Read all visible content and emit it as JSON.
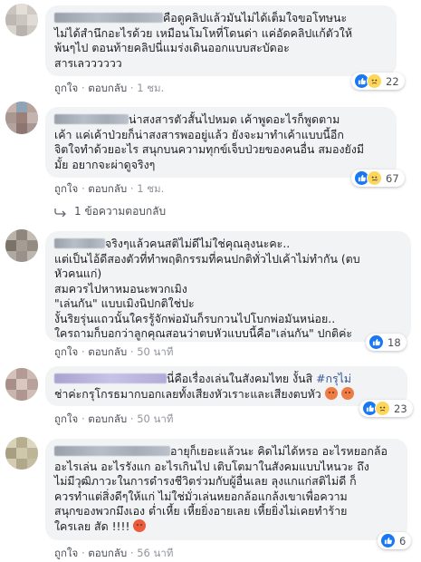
{
  "labels": {
    "like": "ถูกใจ",
    "reply": "ตอบกลับ",
    "dot": "·"
  },
  "colors": {
    "like_blue": "#1877f2",
    "bubble_bg": "#f2f3f5",
    "meta_gray": "#90949c",
    "link_blue": "#385898"
  },
  "comments": [
    {
      "lines": [
        "คือดูคลิปแล้วมันไม่ได้เต็มใจขอโทษนะ",
        "ไม่ได้สำนึกอะไรด้วย เหมือนโมโหที่โดนด่า แค่อัดคลิปแก้ตัวให้",
        "พ้นๆไป ตอนท้ายคลิปนี่แมร่งเดินออกแบบสะบัดอะ",
        "สารเลวววววว"
      ],
      "time": "1 ชม.",
      "reaction_count": "22",
      "reaction_icons": [
        "like-icon",
        "sad-face-icon"
      ]
    },
    {
      "lines": [
        "น่าสงสารตัวสั้นไปหมด เค้าพูดอะไรก็พูดตาม",
        "เค้า แค่เค้าป่วยก็น่าสงสารพออยู่แล้ว ยังจะมาทำเค้าแบบนี้อีก",
        "จิตใจทำด้วยอะไร สนุกบนความทุกข์เจ็บป่วยของคนอื่น สมองยังมี",
        "มั้ย อยากจะผ่าดูจริงๆ"
      ],
      "time": "1 ชม.",
      "reaction_count": "67",
      "reaction_icons": [
        "like-icon",
        "sad-face-icon"
      ],
      "reply_link": "1 ข้อความตอบกลับ"
    },
    {
      "lines": [
        "จริงๆแล้วคนสติไม่ดีไม่ใช่คุณลุงนะคะ..",
        "แต่เป็นไอ้ดีสองตัวที่ทำพฤติกรรมที่คนปกติทั่วไปเค้าไม่ทำกัน (ตบ",
        "หัวคนแก่)",
        "สมควรไปหาหมอนะพวกเมิง",
        "\"เล่นกัน\" แบบเมิงนิปกติใช่ปะ",
        "งั้นริยรุ่นแถวนั้นใครรู้จักพ่อมันก็รบกวนไปโบกพ่อมันหน่อย..",
        "ใครถามก็บอกว่าลูกคุณสอนว่าตบหัวแบบนี้คือ\"เล่นกัน\" ปกติค่ะ"
      ],
      "name_partial": "ผัง",
      "time": "50 นาที",
      "reaction_count": "18",
      "reaction_icons": [
        "like-icon"
      ]
    },
    {
      "lines": [
        "นี่คือเรื่องเล่นในสังคมไทย งั้นสิ",
        "ช่าค่ะกรุโกรธมากบอกเลยทั้งเสียงหัวเราะและเสียงตบหัว"
      ],
      "hashtag": "#กรุไม่",
      "time": "50 นาที",
      "reaction_count": "23",
      "reaction_icons": [
        "like-icon",
        "sad-face-icon"
      ]
    },
    {
      "lines": [
        "อายุก็เยอะแล้วนะ คิดไม่ได้หรอ อะไรหยอกล้อ",
        "อะไรเล่น อะไรรังแก อะไรเกินไป เติบโตมาในสังคมแบบไหนวะ ถึง",
        "ไม่มีวุฒิภาวะในการดำรงชีวิตร่วมกับผู้อื่นเลย ลุงแกแก่สติไม่ดี ก็",
        "ควรทำแต่สิ่งดีๆให้แก่ ไม่ใช่มั่วเล่นหยอกล้อแกล้งเขาเพื่อความ",
        "สนุกของพวกมึงเอง ต่ำเหี้ย เหี้ยยิ่งอายเลย เหี้ยยิ่งไม่เคยทำร้าย",
        "ใครเลย สัด !!!!"
      ],
      "time": "56 นาที",
      "reaction_count": "6",
      "reaction_icons": [
        "like-icon"
      ]
    }
  ]
}
